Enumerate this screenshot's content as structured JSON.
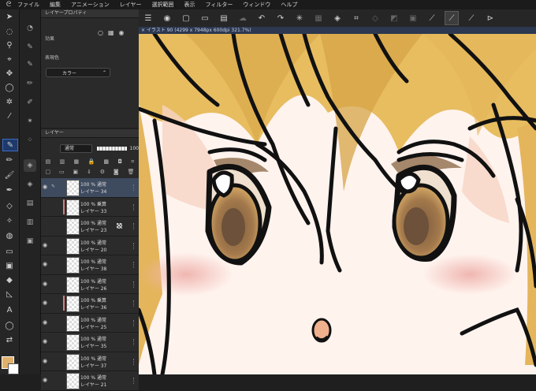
{
  "menu": [
    "ファイル",
    "編集",
    "アニメーション",
    "レイヤー",
    "選択範囲",
    "表示",
    "フィルター",
    "ウィンドウ",
    "ヘルプ"
  ],
  "document_tab": "× イラスト 90 (4299 x 7948px 600dpi 321.7%)",
  "properties": {
    "title": "レイヤープロパティ",
    "effect_label": "効果",
    "expression_label": "表現色",
    "expression_value": "カラー"
  },
  "layers_panel": {
    "title": "レイヤー",
    "blend_mode": "通常",
    "opacity": "100"
  },
  "layers": [
    {
      "l1": "100 % 通常",
      "l2": "レイヤー 34",
      "selected": true,
      "visible": true,
      "clip": false,
      "mark": false
    },
    {
      "l1": "100 % 乗算",
      "l2": "レイヤー 33",
      "selected": false,
      "visible": false,
      "clip": true,
      "mark": false
    },
    {
      "l1": "100 % 通常",
      "l2": "レイヤー 23",
      "selected": false,
      "visible": false,
      "clip": false,
      "mark": true
    },
    {
      "l1": "100 % 通常",
      "l2": "レイヤー 20",
      "selected": false,
      "visible": true,
      "clip": false,
      "mark": false
    },
    {
      "l1": "100 % 通常",
      "l2": "レイヤー 38",
      "selected": false,
      "visible": true,
      "clip": false,
      "mark": false
    },
    {
      "l1": "100 % 通常",
      "l2": "レイヤー 26",
      "selected": false,
      "visible": true,
      "clip": false,
      "mark": false
    },
    {
      "l1": "100 % 乗算",
      "l2": "レイヤー 36",
      "selected": false,
      "visible": true,
      "clip": true,
      "mark": false
    },
    {
      "l1": "100 % 通常",
      "l2": "レイヤー 25",
      "selected": false,
      "visible": true,
      "clip": false,
      "mark": false
    },
    {
      "l1": "100 % 通常",
      "l2": "レイヤー 35",
      "selected": false,
      "visible": true,
      "clip": false,
      "mark": false
    },
    {
      "l1": "100 % 通常",
      "l2": "レイヤー 37",
      "selected": false,
      "visible": true,
      "clip": false,
      "mark": false
    },
    {
      "l1": "100 % 通常",
      "l2": "レイヤー 21",
      "selected": false,
      "visible": true,
      "clip": false,
      "mark": false
    }
  ],
  "colors": {
    "accent": "#3c6bc4",
    "fg_color": "#e0b16a",
    "bg_color": "#ffffff",
    "hair": "#e8bd60",
    "skin": "#fff3ee"
  }
}
